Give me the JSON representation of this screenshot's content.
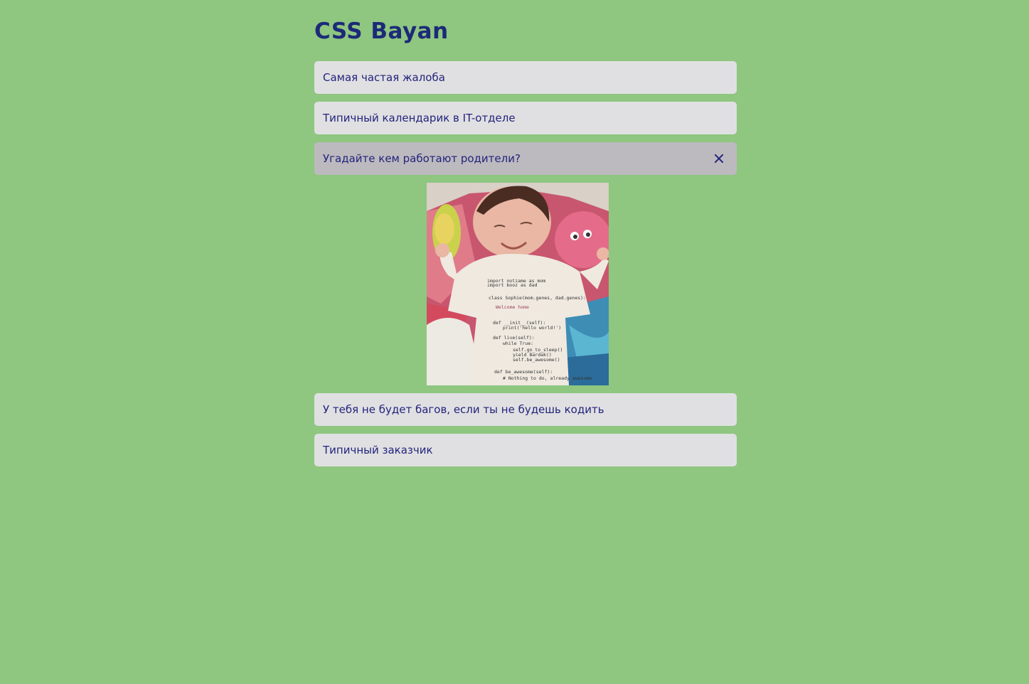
{
  "title": "CSS Bayan",
  "items": [
    {
      "label": "Самая частая жалоба",
      "open": false
    },
    {
      "label": "Типичный календарик в IT-отделе",
      "open": false
    },
    {
      "label": "Угадайте кем работают родители?",
      "open": true,
      "icon": "close-icon"
    },
    {
      "label": "У тебя не будет багов, если ты не будешь кодить",
      "open": false
    },
    {
      "label": "Типичный заказчик",
      "open": false
    }
  ],
  "photo": {
    "shirt_lines": [
      "import notiame as mom",
      "import booz as dad",
      "class Sophie(mom.genes, dad.genes):",
      "Welcome home",
      "def __init__(self):",
      "print('hello world!')",
      "def live(self):",
      "while True:",
      "self.go_to_sleep()",
      "yield Bardak()",
      "self.be_awesome()",
      "def be_awesome(self):",
      "# Nothing to do, already awesome"
    ]
  },
  "colors": {
    "background": "#8fc680",
    "item_bg": "#e0e0e2",
    "item_open_bg": "#bcbabe",
    "text": "#23237d"
  }
}
